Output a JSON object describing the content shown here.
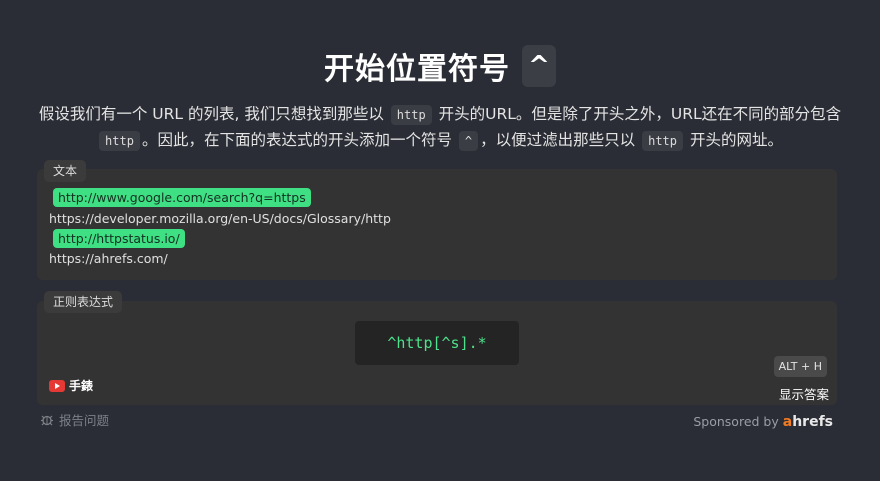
{
  "title": {
    "text": "开始位置符号",
    "chip": "^"
  },
  "description": {
    "part1": "假设我们有一个 URL 的列表, 我们只想找到那些以",
    "chip1": "http",
    "part2": "开头的URL。但是除了开头之外，URL还在不同的部分包含",
    "chip2": "http",
    "part3": "。因此，在下面的表达式的开头添加一个符号",
    "chip3": "^",
    "part4": "，以便过滤出那些只以",
    "chip4": "http",
    "part5": "开头的网址。"
  },
  "text_panel": {
    "tab_label": "文本",
    "lines": [
      {
        "text": "http://www.google.com/search?q=https",
        "matched": true
      },
      {
        "text": "https://developer.mozilla.org/en-US/docs/Glossary/http",
        "matched": false
      },
      {
        "text": "http://httpstatus.io/",
        "matched": true
      },
      {
        "text": "https://ahrefs.com/",
        "matched": false
      }
    ]
  },
  "regex_panel": {
    "tab_label": "正则表达式",
    "expression": "^http[^s].*",
    "shortcut": "ALT + H",
    "show_answer": "显示答案",
    "youtube_label": "手錶",
    "youtube_icon": "youtube-icon"
  },
  "footer": {
    "report_label": "报告问题",
    "report_icon": "bug-icon",
    "sponsored_by": "Sponsored by",
    "brand_a": "a",
    "brand_rest": "hrefs"
  },
  "colors": {
    "background": "#2a2d35",
    "panel": "#333333",
    "match_highlight": "#3fdf84",
    "regex_text": "#4ee08a",
    "brand_accent": "#f27b21"
  }
}
